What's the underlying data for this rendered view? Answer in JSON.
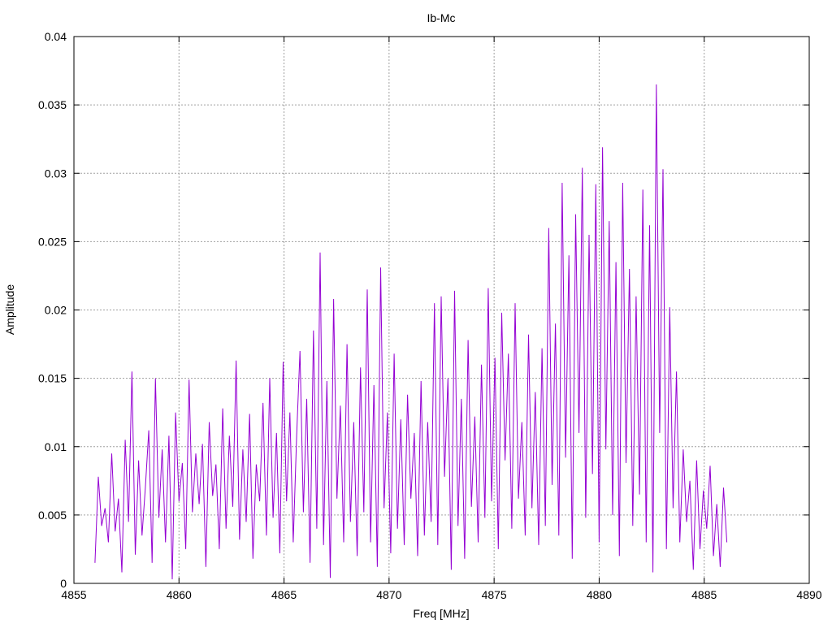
{
  "chart_data": {
    "type": "line",
    "title": "Ib-Mc",
    "xlabel": "Freq [MHz]",
    "ylabel": "Amplitude",
    "xlim": [
      4855,
      4890
    ],
    "ylim": [
      0,
      0.04
    ],
    "grid": true,
    "legend": "none",
    "xticks": [
      "4855",
      "4860",
      "4865",
      "4870",
      "4875",
      "4880",
      "4885",
      "4890"
    ],
    "yticks": [
      "0",
      "0.005",
      "0.01",
      "0.015",
      "0.02",
      "0.025",
      "0.03",
      "0.035",
      "0.04"
    ],
    "series": [
      {
        "name": "Ib-Mc",
        "color": "#9400d3",
        "x_start": 4856,
        "x_step": 0.16,
        "values": [
          0.0015,
          0.0078,
          0.0042,
          0.0055,
          0.003,
          0.0095,
          0.0038,
          0.0062,
          0.0008,
          0.0105,
          0.0045,
          0.0155,
          0.0021,
          0.009,
          0.0035,
          0.007,
          0.0112,
          0.0015,
          0.015,
          0.0048,
          0.0098,
          0.003,
          0.0108,
          0.0003,
          0.0125,
          0.006,
          0.0088,
          0.0025,
          0.0149,
          0.0052,
          0.0095,
          0.0058,
          0.0102,
          0.0012,
          0.0118,
          0.0064,
          0.0087,
          0.0025,
          0.0128,
          0.004,
          0.0108,
          0.0056,
          0.0163,
          0.0032,
          0.0098,
          0.0045,
          0.0124,
          0.0018,
          0.0087,
          0.006,
          0.0132,
          0.0035,
          0.015,
          0.0048,
          0.011,
          0.0022,
          0.0162,
          0.006,
          0.0125,
          0.003,
          0.0108,
          0.017,
          0.0052,
          0.0135,
          0.0015,
          0.0185,
          0.004,
          0.0242,
          0.0028,
          0.0148,
          0.0004,
          0.0208,
          0.0062,
          0.013,
          0.003,
          0.0175,
          0.0045,
          0.0118,
          0.002,
          0.0158,
          0.0052,
          0.0215,
          0.003,
          0.0145,
          0.0012,
          0.0231,
          0.0055,
          0.0125,
          0.0022,
          0.0168,
          0.004,
          0.012,
          0.0028,
          0.0138,
          0.0062,
          0.011,
          0.002,
          0.0148,
          0.0035,
          0.0118,
          0.0045,
          0.0205,
          0.0028,
          0.021,
          0.0078,
          0.015,
          0.001,
          0.0214,
          0.0042,
          0.0135,
          0.0018,
          0.0178,
          0.0056,
          0.0122,
          0.003,
          0.016,
          0.0048,
          0.0216,
          0.006,
          0.0165,
          0.0025,
          0.0198,
          0.009,
          0.0168,
          0.004,
          0.0205,
          0.0062,
          0.0118,
          0.0035,
          0.0182,
          0.0055,
          0.014,
          0.0028,
          0.0172,
          0.0042,
          0.026,
          0.0072,
          0.019,
          0.0035,
          0.0293,
          0.0092,
          0.024,
          0.0018,
          0.027,
          0.011,
          0.0304,
          0.0048,
          0.0255,
          0.008,
          0.0292,
          0.003,
          0.0319,
          0.0098,
          0.0265,
          0.005,
          0.0235,
          0.002,
          0.0293,
          0.0088,
          0.023,
          0.0042,
          0.021,
          0.0065,
          0.0288,
          0.003,
          0.0262,
          0.0008,
          0.0365,
          0.011,
          0.0303,
          0.0025,
          0.0202,
          0.0055,
          0.0155,
          0.003,
          0.0098,
          0.0045,
          0.0075,
          0.001,
          0.009,
          0.0025,
          0.0068,
          0.004,
          0.0086,
          0.002,
          0.0058,
          0.0012,
          0.007,
          0.003
        ]
      }
    ]
  }
}
